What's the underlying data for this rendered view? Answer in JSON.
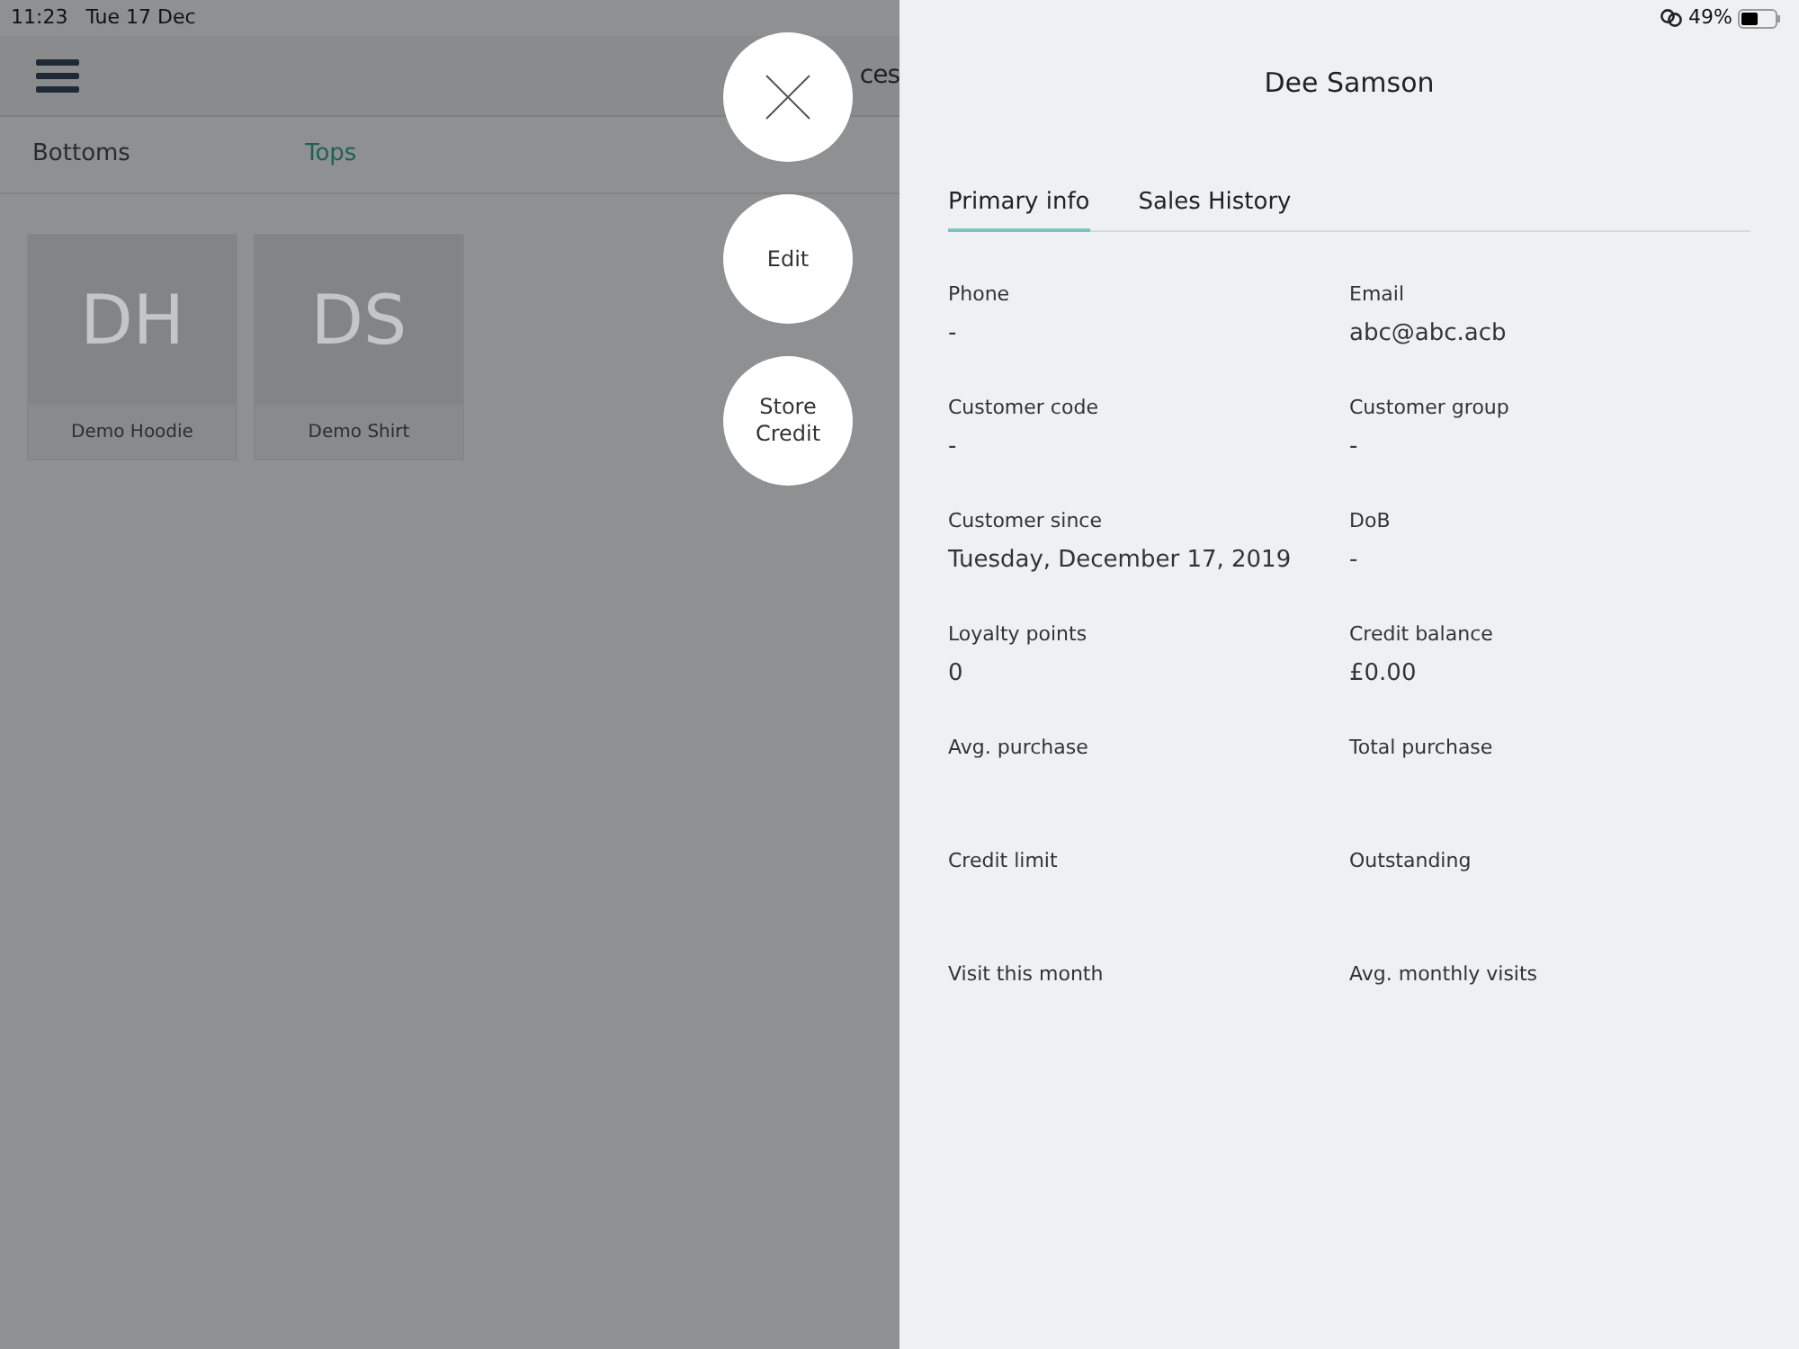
{
  "status_bar": {
    "time": "11:23",
    "date": "Tue 17 Dec",
    "battery": "49%"
  },
  "background": {
    "header_title": "ces",
    "categories": [
      {
        "label": "Bottoms",
        "selected": false
      },
      {
        "label": "Tops",
        "selected": true
      }
    ],
    "products": [
      {
        "initials": "DH",
        "name": "Demo Hoodie"
      },
      {
        "initials": "DS",
        "name": "Demo Shirt"
      }
    ]
  },
  "actions": [
    {
      "kind": "close"
    },
    {
      "kind": "text",
      "label": "Edit"
    },
    {
      "kind": "text",
      "label": "Store Credit"
    }
  ],
  "customer": {
    "name": "Dee Samson",
    "tabs": [
      {
        "label": "Primary info",
        "selected": true
      },
      {
        "label": "Sales History",
        "selected": false
      }
    ],
    "fields": [
      {
        "label": "Phone",
        "value": "-"
      },
      {
        "label": "Email",
        "value": "abc@abc.acb"
      },
      {
        "label": "Customer code",
        "value": "-"
      },
      {
        "label": "Customer group",
        "value": "-"
      },
      {
        "label": "Customer since",
        "value": "Tuesday, December 17, 2019"
      },
      {
        "label": "DoB",
        "value": "-"
      },
      {
        "label": "Loyalty points",
        "value": "0"
      },
      {
        "label": "Credit balance",
        "value": "£0.00"
      },
      {
        "label": "Avg. purchase"
      },
      {
        "label": "Total purchase"
      },
      {
        "label": "Credit limit"
      },
      {
        "label": "Outstanding"
      },
      {
        "label": "Visit this month"
      },
      {
        "label": "Avg. monthly visits"
      }
    ]
  }
}
